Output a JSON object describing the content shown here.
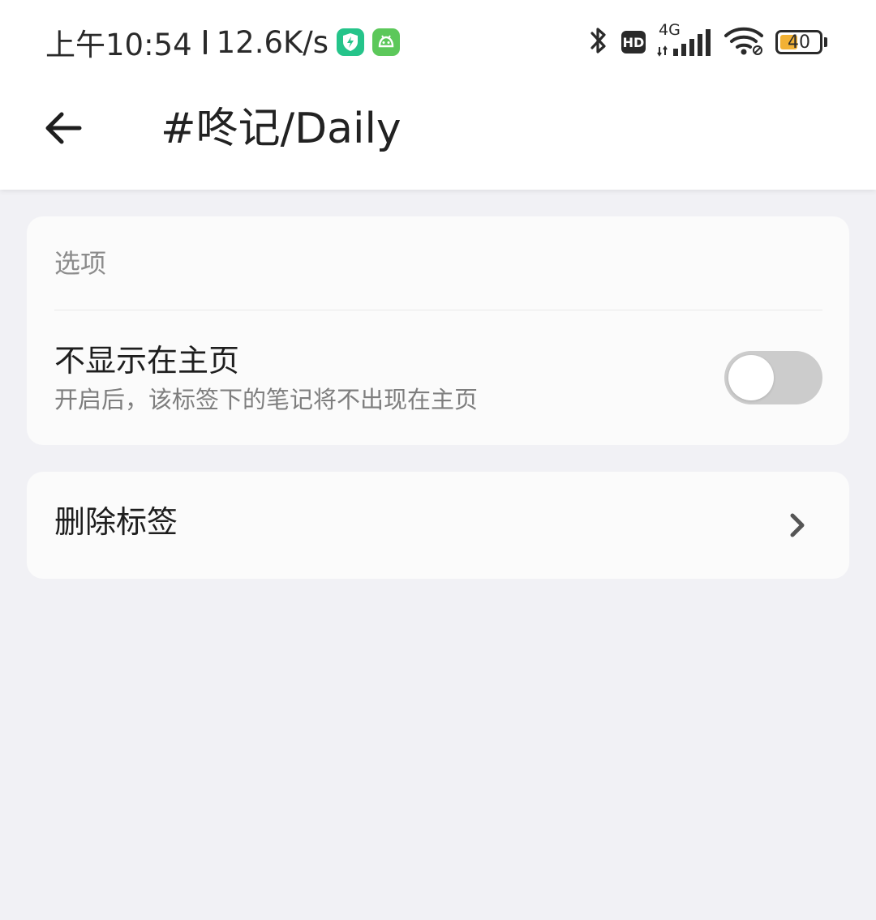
{
  "status_bar": {
    "time": "上午10:54",
    "net_speed": "12.6K/s",
    "battery_level": "40",
    "battery_fraction": 0.4,
    "network_type": "4G",
    "hd_label": "HD",
    "icons": [
      "shield-bolt-app-icon",
      "android-app-icon",
      "bluetooth-icon",
      "hd-icon",
      "signal-icon",
      "wifi-icon",
      "battery-icon"
    ],
    "colors": {
      "shield_app": "#25c48a",
      "android_app": "#5cc85a",
      "battery_fill": "#f2b134"
    }
  },
  "header": {
    "title": "#咚记/Daily",
    "back_icon": "arrow-left-icon"
  },
  "options_card": {
    "section_label": "选项",
    "hide_on_home": {
      "title": "不显示在主页",
      "subtitle": "开启后，该标签下的笔记将不出现在主页",
      "enabled": false
    }
  },
  "delete_card": {
    "label": "删除标签",
    "icon": "chevron-right-icon"
  },
  "colors": {
    "background": "#f1f1f5",
    "card": "#fbfbfb",
    "toggle_off": "#cccccc"
  }
}
